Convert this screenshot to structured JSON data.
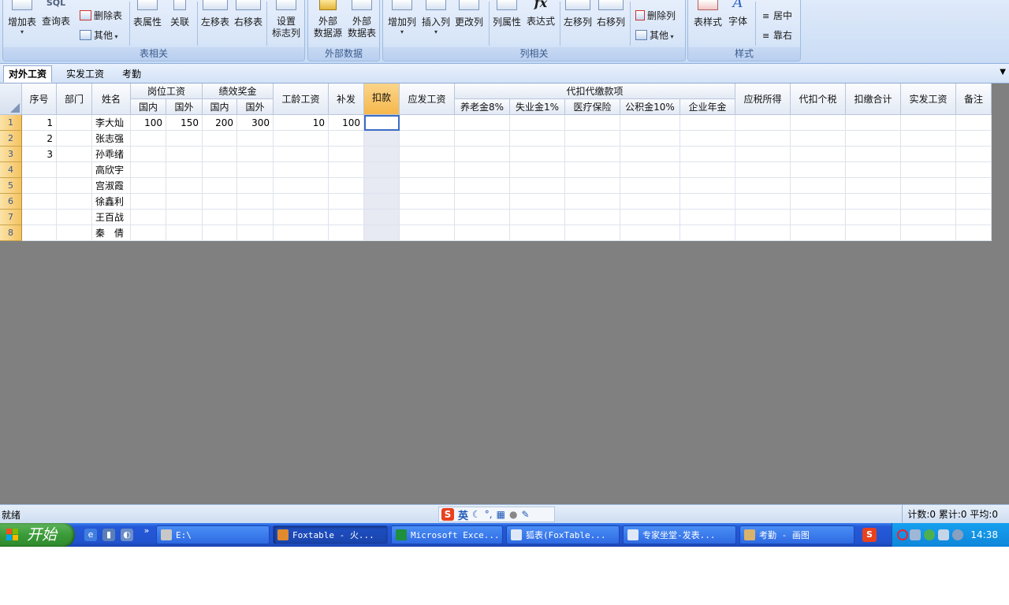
{
  "ribbon": {
    "groups": [
      {
        "label": "表相关"
      },
      {
        "label": "外部数据"
      },
      {
        "label": "列相关"
      },
      {
        "label": "样式"
      }
    ],
    "table": {
      "add_table": "增加表",
      "query_table": "查询表",
      "delete_table": "删除表",
      "other": "其他",
      "table_props": "表属性",
      "relation": "关联",
      "move_left": "左移表",
      "move_right": "右移表",
      "set_flag_line1": "设置",
      "set_flag_line2": "标志列",
      "sql_label": "SQL"
    },
    "external": {
      "source_line1": "外部",
      "source_line2": "数据源",
      "table_line1": "外部",
      "table_line2": "数据表"
    },
    "column": {
      "add_col": "增加列",
      "insert_col": "插入列",
      "change_col": "更改列",
      "col_props": "列属性",
      "expression": "表达式",
      "move_left": "左移列",
      "move_right": "右移列",
      "delete_col": "删除列",
      "other": "其他"
    },
    "style": {
      "table_style": "表样式",
      "font": "字体",
      "center": "居中",
      "align_right": "靠右"
    }
  },
  "tabs": [
    {
      "label": "对外工资",
      "active": true
    },
    {
      "label": "实发工资",
      "active": false
    },
    {
      "label": "考勤",
      "active": false
    }
  ],
  "grid": {
    "headers": {
      "seq": "序号",
      "dept": "部门",
      "name": "姓名",
      "post_wage": "岗位工资",
      "perf_bonus": "绩效奖金",
      "domestic": "国内",
      "foreign": "国外",
      "seniority": "工龄工资",
      "subsidy": "补发",
      "deduct": "扣款",
      "payable": "应发工资",
      "withhold_group": "代扣代缴款项",
      "pension": "养老金8%",
      "unemployment": "失业金1%",
      "medical": "医疗保险",
      "housing_fund": "公积金10%",
      "enterprise_annuity": "企业年金",
      "taxable": "应税所得",
      "withhold_tax": "代扣个税",
      "withhold_total": "扣缴合计",
      "net_pay": "实发工资",
      "remark": "备注"
    },
    "rows": [
      {
        "num": "1",
        "seq": "1",
        "name": "李大灿",
        "post_dom": "100",
        "post_for": "150",
        "perf_dom": "200",
        "perf_for": "300",
        "seniority": "10",
        "subsidy": "100"
      },
      {
        "num": "2",
        "seq": "2",
        "name": "张志强",
        "post_dom": "",
        "post_for": "",
        "perf_dom": "",
        "perf_for": "",
        "seniority": "",
        "subsidy": ""
      },
      {
        "num": "3",
        "seq": "3",
        "name": "孙乖绪",
        "post_dom": "",
        "post_for": "",
        "perf_dom": "",
        "perf_for": "",
        "seniority": "",
        "subsidy": ""
      },
      {
        "num": "4",
        "seq": "",
        "name": "高欣宇",
        "post_dom": "",
        "post_for": "",
        "perf_dom": "",
        "perf_for": "",
        "seniority": "",
        "subsidy": ""
      },
      {
        "num": "5",
        "seq": "",
        "name": "宫淑霞",
        "post_dom": "",
        "post_for": "",
        "perf_dom": "",
        "perf_for": "",
        "seniority": "",
        "subsidy": ""
      },
      {
        "num": "6",
        "seq": "",
        "name": "徐鑫利",
        "post_dom": "",
        "post_for": "",
        "perf_dom": "",
        "perf_for": "",
        "seniority": "",
        "subsidy": ""
      },
      {
        "num": "7",
        "seq": "",
        "name": "王百战",
        "post_dom": "",
        "post_for": "",
        "perf_dom": "",
        "perf_for": "",
        "seniority": "",
        "subsidy": ""
      },
      {
        "num": "8",
        "seq": "",
        "name": "秦　倩",
        "post_dom": "",
        "post_for": "",
        "perf_dom": "",
        "perf_for": "",
        "seniority": "",
        "subsidy": ""
      }
    ]
  },
  "status": {
    "ready": "就绪",
    "ime_lang": "英",
    "summary": "计数:0 累计:0 平均:0"
  },
  "taskbar": {
    "start": "开始",
    "tasks": [
      {
        "label": "E:\\",
        "active": false
      },
      {
        "label": "Foxtable - 火...",
        "active": true
      },
      {
        "label": "Microsoft Exce...",
        "active": false
      },
      {
        "label": "狐表(FoxTable...",
        "active": false
      },
      {
        "label": "专家坐堂-发表...",
        "active": false
      },
      {
        "label": "考勤 - 画图",
        "active": false
      }
    ],
    "clock": "14:38"
  },
  "colors": {
    "ribbon_bg": "#d7e5f8",
    "selected_header": "#f5b74c",
    "grid_bg": "#808080",
    "taskbar": "#2253cf",
    "start_button": "#3a9b38"
  }
}
